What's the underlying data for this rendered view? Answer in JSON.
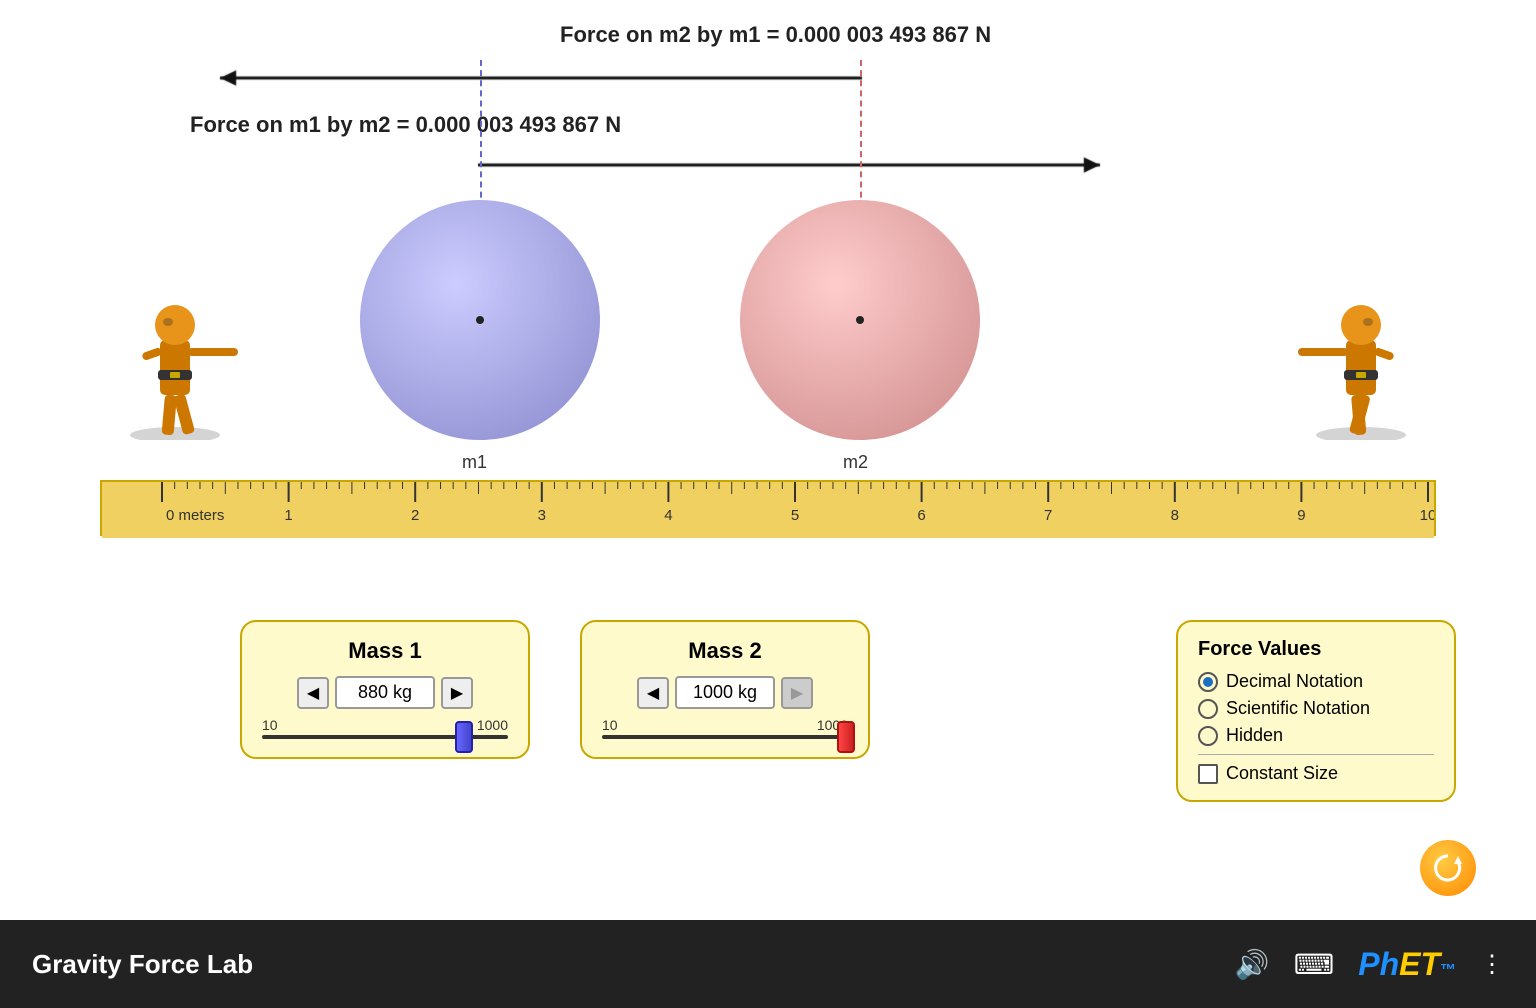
{
  "title": "Gravity Force Lab",
  "sim": {
    "force_label_m2_by_m1": "Force on m2 by m1 = 0.000 003 493 867 N",
    "force_label_m1_by_m2": "Force on m1 by m2 = 0.000 003 493 867 N",
    "m1_label": "m1",
    "m2_label": "m2"
  },
  "ruler": {
    "unit": "meters",
    "marks": [
      "0",
      "1",
      "2",
      "3",
      "4",
      "5",
      "6",
      "7",
      "8",
      "9",
      "10"
    ]
  },
  "mass1": {
    "title": "Mass 1",
    "value": "880 kg",
    "min": "10",
    "max": "1000",
    "slider_pct": 0.87
  },
  "mass2": {
    "title": "Mass 2",
    "value": "1000 kg",
    "min": "10",
    "max": "1000",
    "slider_pct": 0.99
  },
  "force_values": {
    "title": "Force Values",
    "options": [
      {
        "label": "Decimal Notation",
        "selected": true
      },
      {
        "label": "Scientific Notation",
        "selected": false
      },
      {
        "label": "Hidden",
        "selected": false
      }
    ],
    "constant_size_label": "Constant Size"
  },
  "bottom_bar": {
    "title": "Gravity Force Lab",
    "reset_label": "↺"
  }
}
